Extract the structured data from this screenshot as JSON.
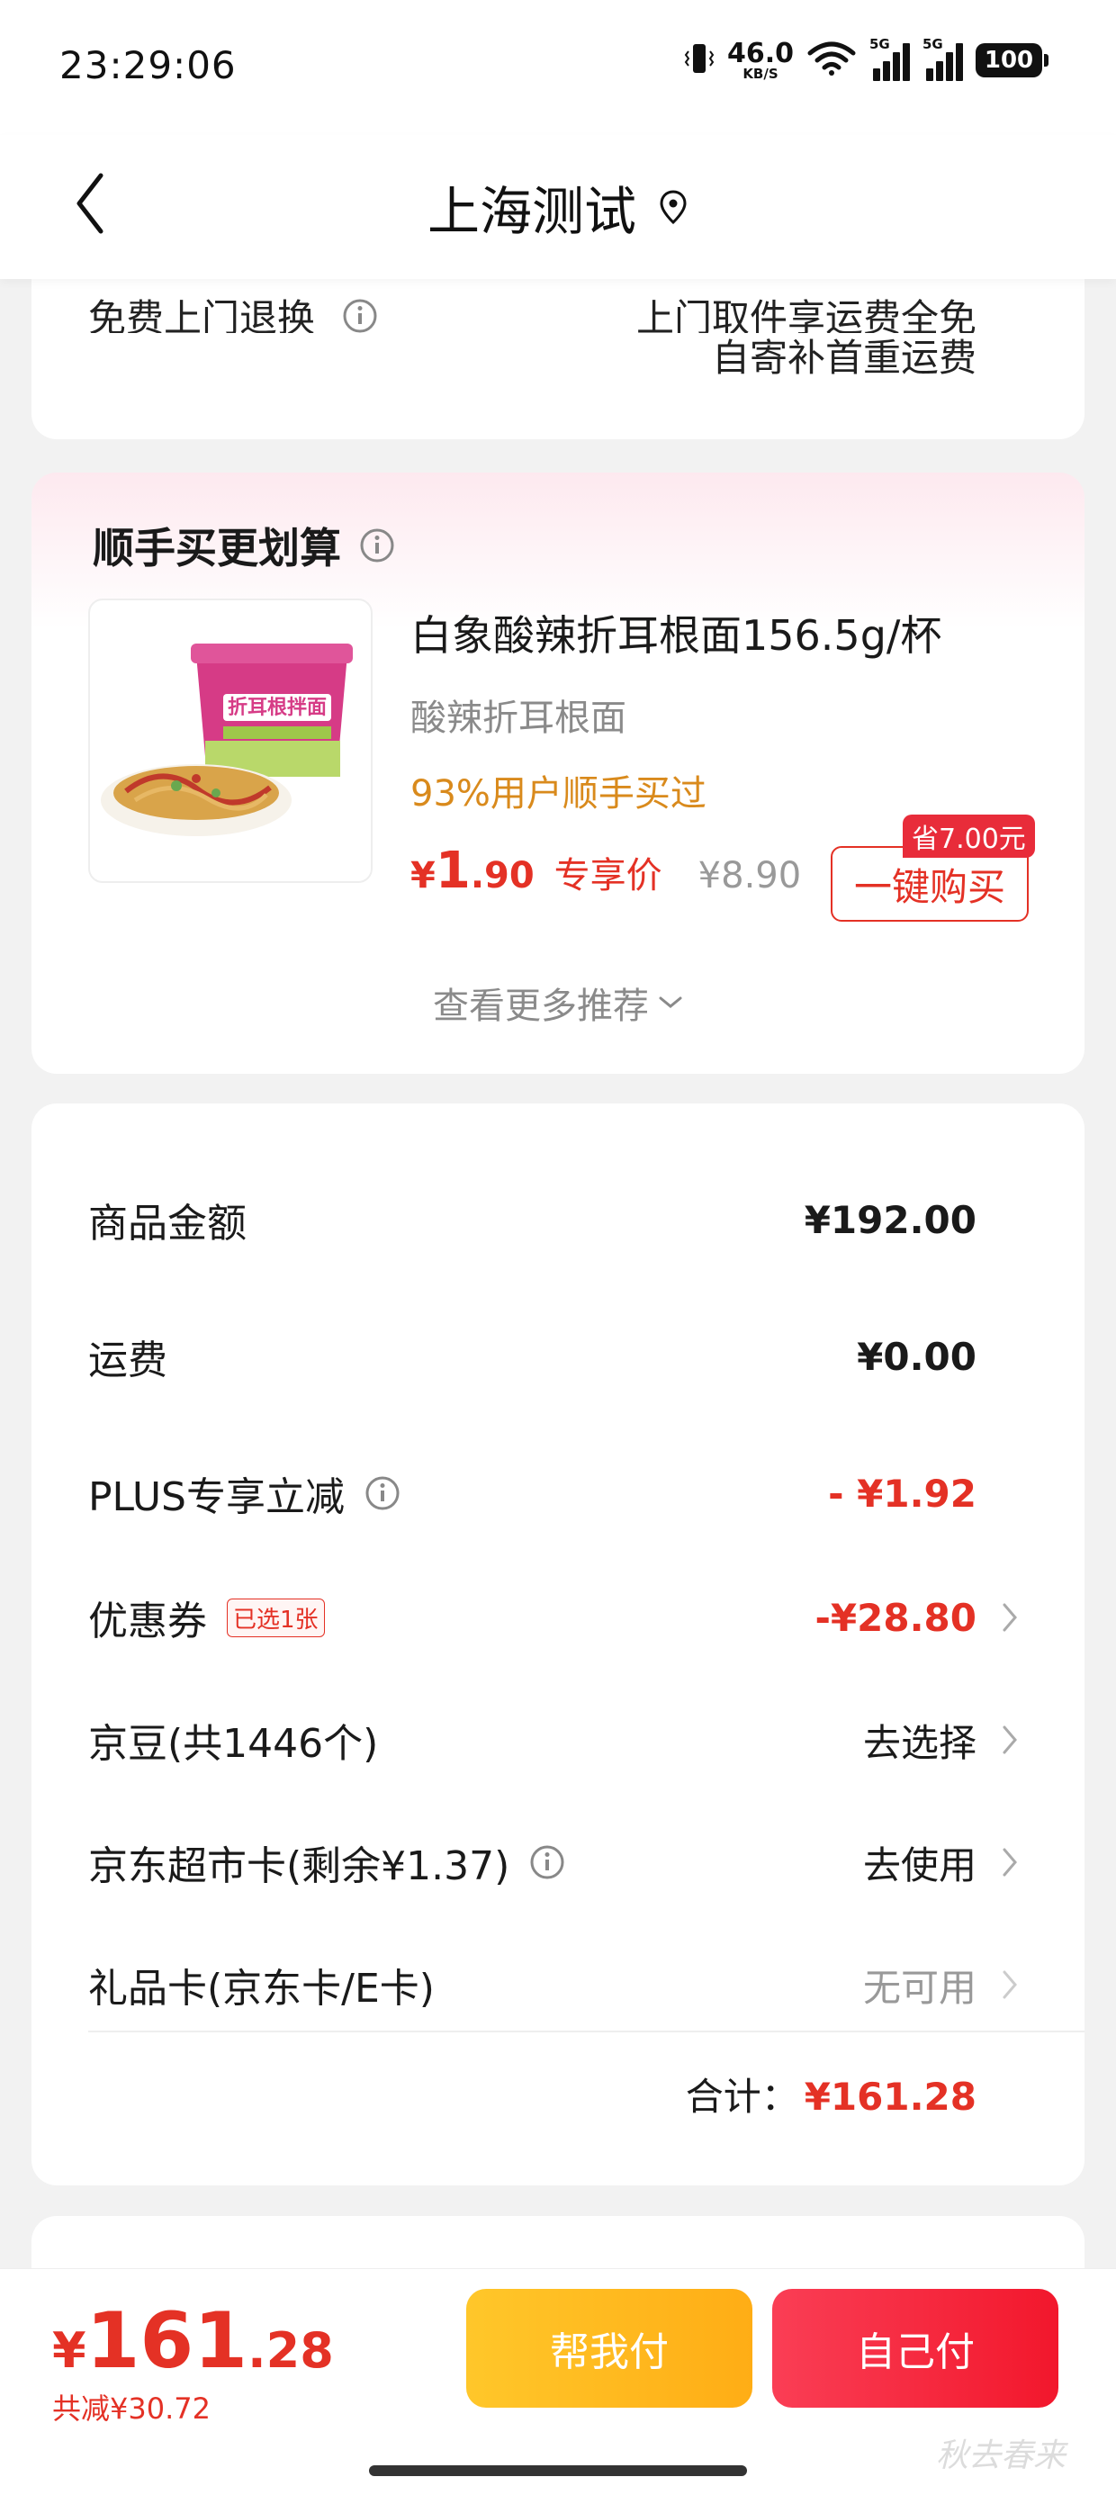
{
  "status_bar": {
    "time": "23:29:06",
    "net_speed": "46.0",
    "net_unit": "KB/S",
    "signal_1_label": "5G",
    "signal_2_label": "5G",
    "battery": "100"
  },
  "header": {
    "title": "上海测试"
  },
  "top_card": {
    "left_text": "免费上门退换",
    "right_text": "上门取件享运费全免",
    "note": "自寄补首重运费"
  },
  "recommend": {
    "title": "顺手买更划算",
    "product": {
      "name": "白象酸辣折耳根面156.5g/杯",
      "subtitle": "酸辣折耳根面",
      "stat": "93%用户顺手买过",
      "price_yen": "¥",
      "price_int": "1",
      "price_dec": ".90",
      "price_tag": "专享价",
      "original_price": "¥8.90",
      "save_badge": "省7.00元",
      "buy_label": "一键购买",
      "image_text": "折耳根拌面"
    },
    "more_label": "查看更多推荐"
  },
  "summary": {
    "rows": [
      {
        "label": "商品金额",
        "value": "¥192.00"
      },
      {
        "label": "运费",
        "value": "¥0.00"
      },
      {
        "label": "PLUS专享立减",
        "value": "- ¥1.92"
      },
      {
        "label": "优惠券",
        "tag": "已选1张",
        "value": "-¥28.80"
      },
      {
        "label": "京豆(共1446个)",
        "value": "去选择"
      },
      {
        "label": "京东超市卡(剩余¥1.37)",
        "value": "去使用"
      },
      {
        "label": "礼品卡(京东卡/E卡)",
        "value": "无可用"
      }
    ],
    "total_label": "合计：",
    "total_value": "¥161.28"
  },
  "bottom_bar": {
    "pay_yen": "¥",
    "pay_int": "161",
    "pay_dec": ".28",
    "saved": "共减¥30.72",
    "help_pay_label": "帮我付",
    "self_pay_label": "自己付",
    "watermark": "秋去春来"
  },
  "colors": {
    "accent_red": "#e43125",
    "help_pay_yellow": "#ffb81e",
    "self_pay_red": "#f52a40",
    "stat_orange": "#d98a1c"
  }
}
